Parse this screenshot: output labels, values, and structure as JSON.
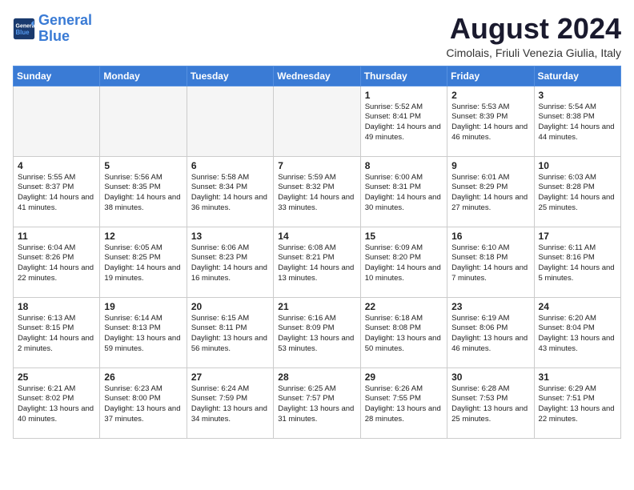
{
  "header": {
    "logo_general": "General",
    "logo_blue": "Blue",
    "month_year": "August 2024",
    "location": "Cimolais, Friuli Venezia Giulia, Italy"
  },
  "days_of_week": [
    "Sunday",
    "Monday",
    "Tuesday",
    "Wednesday",
    "Thursday",
    "Friday",
    "Saturday"
  ],
  "weeks": [
    [
      {
        "day": "",
        "info": "",
        "shaded": true
      },
      {
        "day": "",
        "info": "",
        "shaded": true
      },
      {
        "day": "",
        "info": "",
        "shaded": true
      },
      {
        "day": "",
        "info": "",
        "shaded": true
      },
      {
        "day": "1",
        "info": "Sunrise: 5:52 AM\nSunset: 8:41 PM\nDaylight: 14 hours and 49 minutes.",
        "shaded": false
      },
      {
        "day": "2",
        "info": "Sunrise: 5:53 AM\nSunset: 8:39 PM\nDaylight: 14 hours and 46 minutes.",
        "shaded": false
      },
      {
        "day": "3",
        "info": "Sunrise: 5:54 AM\nSunset: 8:38 PM\nDaylight: 14 hours and 44 minutes.",
        "shaded": false
      }
    ],
    [
      {
        "day": "4",
        "info": "Sunrise: 5:55 AM\nSunset: 8:37 PM\nDaylight: 14 hours and 41 minutes.",
        "shaded": false
      },
      {
        "day": "5",
        "info": "Sunrise: 5:56 AM\nSunset: 8:35 PM\nDaylight: 14 hours and 38 minutes.",
        "shaded": false
      },
      {
        "day": "6",
        "info": "Sunrise: 5:58 AM\nSunset: 8:34 PM\nDaylight: 14 hours and 36 minutes.",
        "shaded": false
      },
      {
        "day": "7",
        "info": "Sunrise: 5:59 AM\nSunset: 8:32 PM\nDaylight: 14 hours and 33 minutes.",
        "shaded": false
      },
      {
        "day": "8",
        "info": "Sunrise: 6:00 AM\nSunset: 8:31 PM\nDaylight: 14 hours and 30 minutes.",
        "shaded": false
      },
      {
        "day": "9",
        "info": "Sunrise: 6:01 AM\nSunset: 8:29 PM\nDaylight: 14 hours and 27 minutes.",
        "shaded": false
      },
      {
        "day": "10",
        "info": "Sunrise: 6:03 AM\nSunset: 8:28 PM\nDaylight: 14 hours and 25 minutes.",
        "shaded": false
      }
    ],
    [
      {
        "day": "11",
        "info": "Sunrise: 6:04 AM\nSunset: 8:26 PM\nDaylight: 14 hours and 22 minutes.",
        "shaded": false
      },
      {
        "day": "12",
        "info": "Sunrise: 6:05 AM\nSunset: 8:25 PM\nDaylight: 14 hours and 19 minutes.",
        "shaded": false
      },
      {
        "day": "13",
        "info": "Sunrise: 6:06 AM\nSunset: 8:23 PM\nDaylight: 14 hours and 16 minutes.",
        "shaded": false
      },
      {
        "day": "14",
        "info": "Sunrise: 6:08 AM\nSunset: 8:21 PM\nDaylight: 14 hours and 13 minutes.",
        "shaded": false
      },
      {
        "day": "15",
        "info": "Sunrise: 6:09 AM\nSunset: 8:20 PM\nDaylight: 14 hours and 10 minutes.",
        "shaded": false
      },
      {
        "day": "16",
        "info": "Sunrise: 6:10 AM\nSunset: 8:18 PM\nDaylight: 14 hours and 7 minutes.",
        "shaded": false
      },
      {
        "day": "17",
        "info": "Sunrise: 6:11 AM\nSunset: 8:16 PM\nDaylight: 14 hours and 5 minutes.",
        "shaded": false
      }
    ],
    [
      {
        "day": "18",
        "info": "Sunrise: 6:13 AM\nSunset: 8:15 PM\nDaylight: 14 hours and 2 minutes.",
        "shaded": false
      },
      {
        "day": "19",
        "info": "Sunrise: 6:14 AM\nSunset: 8:13 PM\nDaylight: 13 hours and 59 minutes.",
        "shaded": false
      },
      {
        "day": "20",
        "info": "Sunrise: 6:15 AM\nSunset: 8:11 PM\nDaylight: 13 hours and 56 minutes.",
        "shaded": false
      },
      {
        "day": "21",
        "info": "Sunrise: 6:16 AM\nSunset: 8:09 PM\nDaylight: 13 hours and 53 minutes.",
        "shaded": false
      },
      {
        "day": "22",
        "info": "Sunrise: 6:18 AM\nSunset: 8:08 PM\nDaylight: 13 hours and 50 minutes.",
        "shaded": false
      },
      {
        "day": "23",
        "info": "Sunrise: 6:19 AM\nSunset: 8:06 PM\nDaylight: 13 hours and 46 minutes.",
        "shaded": false
      },
      {
        "day": "24",
        "info": "Sunrise: 6:20 AM\nSunset: 8:04 PM\nDaylight: 13 hours and 43 minutes.",
        "shaded": false
      }
    ],
    [
      {
        "day": "25",
        "info": "Sunrise: 6:21 AM\nSunset: 8:02 PM\nDaylight: 13 hours and 40 minutes.",
        "shaded": false
      },
      {
        "day": "26",
        "info": "Sunrise: 6:23 AM\nSunset: 8:00 PM\nDaylight: 13 hours and 37 minutes.",
        "shaded": false
      },
      {
        "day": "27",
        "info": "Sunrise: 6:24 AM\nSunset: 7:59 PM\nDaylight: 13 hours and 34 minutes.",
        "shaded": false
      },
      {
        "day": "28",
        "info": "Sunrise: 6:25 AM\nSunset: 7:57 PM\nDaylight: 13 hours and 31 minutes.",
        "shaded": false
      },
      {
        "day": "29",
        "info": "Sunrise: 6:26 AM\nSunset: 7:55 PM\nDaylight: 13 hours and 28 minutes.",
        "shaded": false
      },
      {
        "day": "30",
        "info": "Sunrise: 6:28 AM\nSunset: 7:53 PM\nDaylight: 13 hours and 25 minutes.",
        "shaded": false
      },
      {
        "day": "31",
        "info": "Sunrise: 6:29 AM\nSunset: 7:51 PM\nDaylight: 13 hours and 22 minutes.",
        "shaded": false
      }
    ]
  ]
}
